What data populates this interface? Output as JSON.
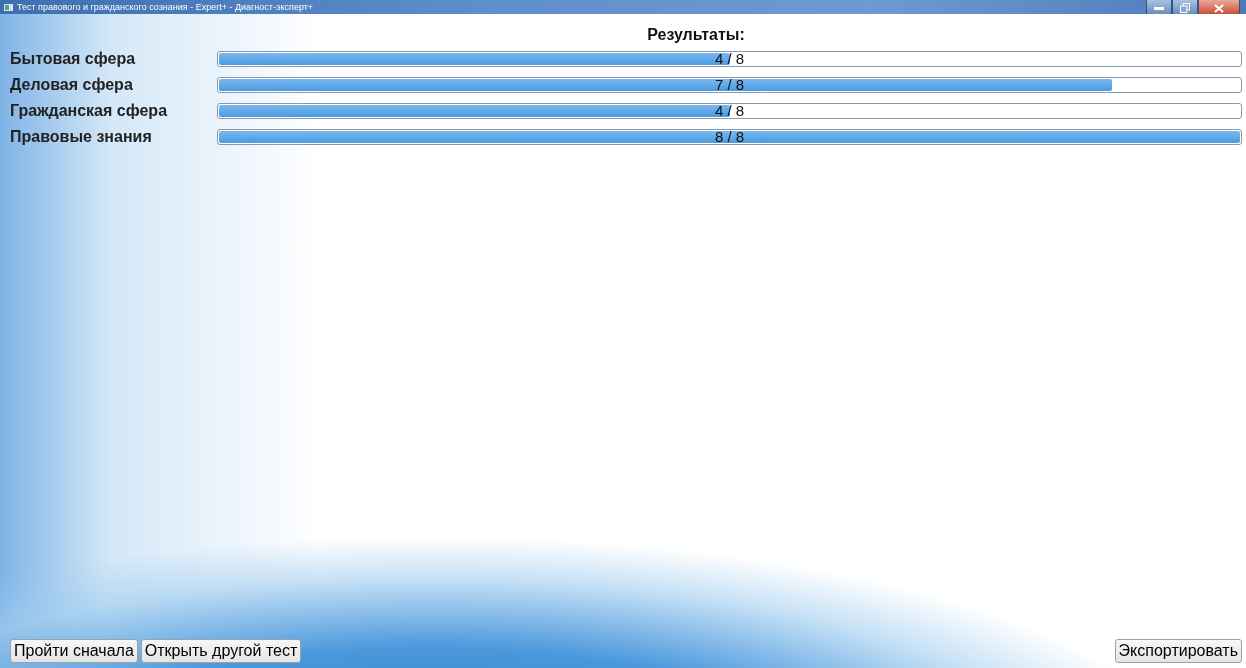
{
  "window": {
    "title": "Тест правового и гражданского сознания - Expert+ - Диагност-эксперт+"
  },
  "heading": "Результаты:",
  "results": [
    {
      "name": "Бытовая сфера",
      "level": 0.5,
      "reading": "4 / 8"
    },
    {
      "name": "Деловая сфера",
      "level": 0.875,
      "reading": "7 / 8"
    },
    {
      "name": "Гражданская сфера",
      "level": 0.5,
      "reading": "4 / 8"
    },
    {
      "name": "Правовые знания",
      "level": 1,
      "reading": "8 / 8"
    }
  ],
  "buttons_left": [
    "Пройти сначала",
    "Открыть другой тест"
  ],
  "buttons_right": [
    "Экспортировать"
  ]
}
